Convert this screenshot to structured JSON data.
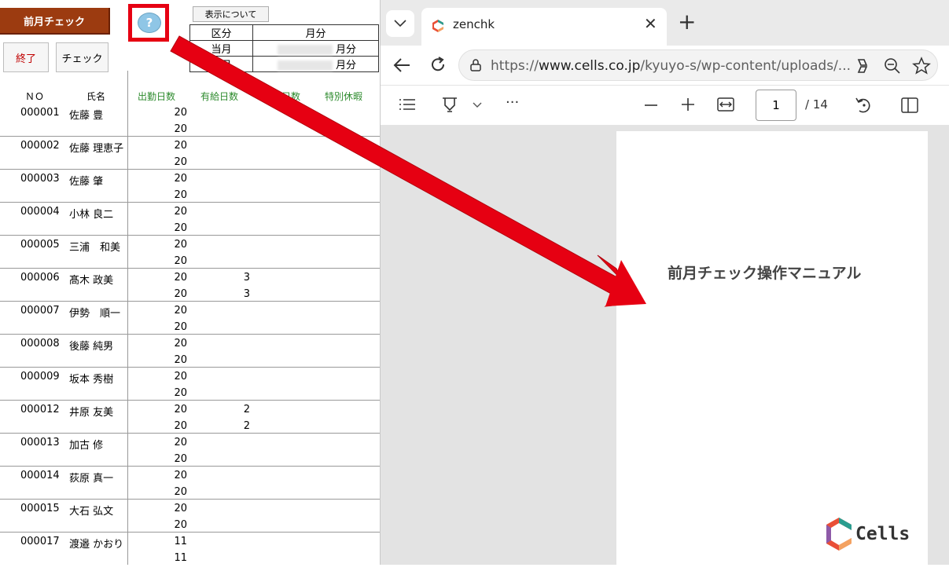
{
  "sheet": {
    "title_button": "前月チェック",
    "help_label": "?",
    "end_button": "終了",
    "check_button": "チェック",
    "display_button": "表示について",
    "info": {
      "kubun": "区分",
      "gappun_header": "月分",
      "current_label": "当月",
      "current_suffix": "月分",
      "previous_label": "前月",
      "previous_suffix": "月分"
    },
    "columns": [
      "ＮＯ",
      "氏名",
      "出勤日数",
      "有給日数",
      "欠勤日数",
      "特別休暇"
    ],
    "rows": [
      {
        "no": "000001",
        "name": "佐藤 豊",
        "a1": "20",
        "a2": "20",
        "b1": "",
        "b2": ""
      },
      {
        "no": "000002",
        "name": "佐藤 理恵子",
        "a1": "20",
        "a2": "20",
        "b1": "",
        "b2": ""
      },
      {
        "no": "000003",
        "name": "佐藤 肇",
        "a1": "20",
        "a2": "20",
        "b1": "",
        "b2": ""
      },
      {
        "no": "000004",
        "name": "小林 良二",
        "a1": "20",
        "a2": "20",
        "b1": "",
        "b2": ""
      },
      {
        "no": "000005",
        "name": "三浦　和美",
        "a1": "20",
        "a2": "20",
        "b1": "",
        "b2": ""
      },
      {
        "no": "000006",
        "name": "髙木 政美",
        "a1": "20",
        "a2": "20",
        "b1": "3",
        "b2": "3"
      },
      {
        "no": "000007",
        "name": "伊勢　順一",
        "a1": "20",
        "a2": "20",
        "b1": "",
        "b2": ""
      },
      {
        "no": "000008",
        "name": "後藤 純男",
        "a1": "20",
        "a2": "20",
        "b1": "",
        "b2": ""
      },
      {
        "no": "000009",
        "name": "坂本 秀樹",
        "a1": "20",
        "a2": "20",
        "b1": "",
        "b2": ""
      },
      {
        "no": "000012",
        "name": "井原 友美",
        "a1": "20",
        "a2": "20",
        "b1": "2",
        "b2": "2"
      },
      {
        "no": "000013",
        "name": "加古 修",
        "a1": "20",
        "a2": "20",
        "b1": "",
        "b2": ""
      },
      {
        "no": "000014",
        "name": "荻原 真一",
        "a1": "20",
        "a2": "20",
        "b1": "",
        "b2": ""
      },
      {
        "no": "000015",
        "name": "大石 弘文",
        "a1": "20",
        "a2": "20",
        "b1": "",
        "b2": ""
      },
      {
        "no": "000017",
        "name": "渡邉 かおり",
        "a1": "11",
        "a2": "11",
        "b1": "",
        "b2": ""
      }
    ]
  },
  "browser": {
    "tab_title": "zenchk",
    "url_prefix": "https://",
    "url_host": "www.cells.co.jp",
    "url_path": "/kyuyo-s/wp-content/uploads/...",
    "page_number": "1",
    "page_total": "/ 14",
    "doc_title": "前月チェック操作マニュアル",
    "logo_text": "Cells"
  },
  "colors": {
    "title_button_bg": "#9c3b10",
    "highlight_red": "#e60012",
    "header_green": "#2e8b2e",
    "end_red": "#c00000"
  }
}
